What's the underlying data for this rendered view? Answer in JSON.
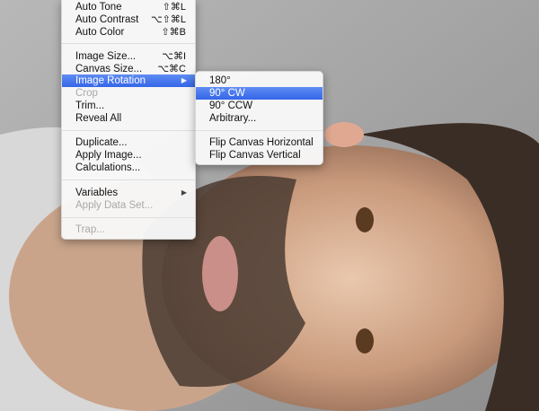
{
  "image_menu": {
    "items": [
      {
        "label": "Auto Tone",
        "shortcut": "⇧⌘L"
      },
      {
        "label": "Auto Contrast",
        "shortcut": "⌥⇧⌘L"
      },
      {
        "label": "Auto Color",
        "shortcut": "⇧⌘B"
      },
      {
        "label": "Image Size...",
        "shortcut": "⌥⌘I"
      },
      {
        "label": "Canvas Size...",
        "shortcut": "⌥⌘C"
      },
      {
        "label": "Image Rotation",
        "arrow": "▶"
      },
      {
        "label": "Crop"
      },
      {
        "label": "Trim..."
      },
      {
        "label": "Reveal All"
      },
      {
        "label": "Duplicate..."
      },
      {
        "label": "Apply Image..."
      },
      {
        "label": "Calculations..."
      },
      {
        "label": "Variables",
        "arrow": "▶"
      },
      {
        "label": "Apply Data Set..."
      },
      {
        "label": "Trap..."
      }
    ]
  },
  "rotation_submenu": {
    "items": [
      {
        "label": "180°"
      },
      {
        "label": "90° CW"
      },
      {
        "label": "90° CCW"
      },
      {
        "label": "Arbitrary..."
      },
      {
        "label": "Flip Canvas Horizontal"
      },
      {
        "label": "Flip Canvas Vertical"
      }
    ]
  },
  "colors": {
    "highlight": "#3f74ec",
    "disabled": "#a8a8a8"
  }
}
